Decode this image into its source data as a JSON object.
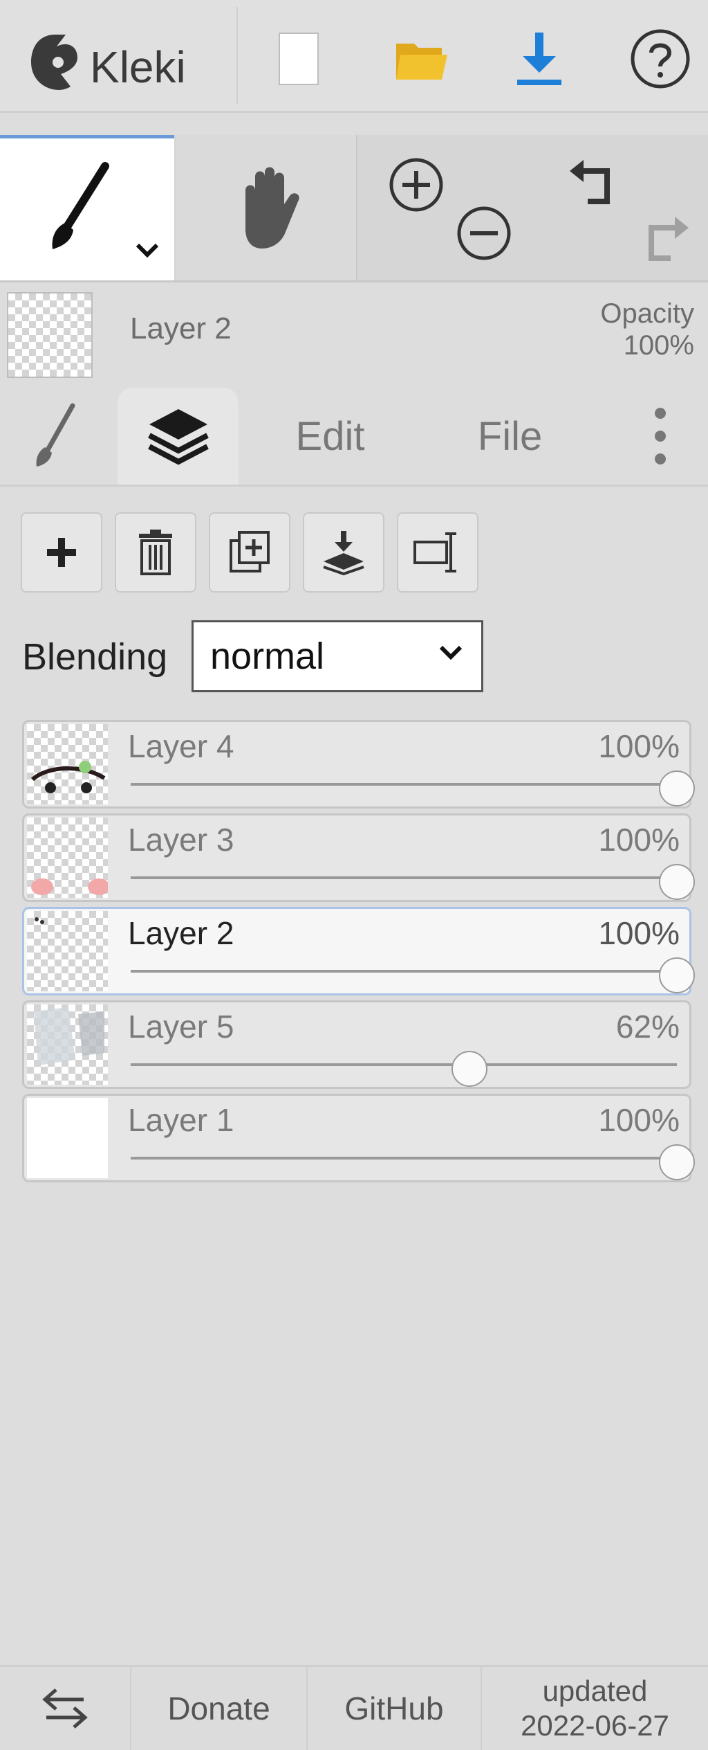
{
  "app": {
    "name": "Kleki"
  },
  "header": {
    "layer_name": "Layer 2",
    "opacity_label": "Opacity",
    "opacity_value": "100%"
  },
  "tabs": [
    {
      "label": "",
      "icon": "brush-icon"
    },
    {
      "label": "",
      "icon": "layers-icon",
      "active": true
    },
    {
      "label": "Edit"
    },
    {
      "label": "File"
    },
    {
      "label": "",
      "icon": "more-vertical-icon"
    }
  ],
  "actions": [
    "add-layer-icon",
    "delete-layer-icon",
    "duplicate-layer-icon",
    "merge-down-icon",
    "rename-layer-icon"
  ],
  "blending": {
    "label": "Blending",
    "value": "normal"
  },
  "layers": [
    {
      "name": "Layer 4",
      "opacity": "100%",
      "opacity_fraction": 1.0
    },
    {
      "name": "Layer 3",
      "opacity": "100%",
      "opacity_fraction": 1.0
    },
    {
      "name": "Layer 2",
      "opacity": "100%",
      "opacity_fraction": 1.0,
      "selected": true
    },
    {
      "name": "Layer 5",
      "opacity": "62%",
      "opacity_fraction": 0.62
    },
    {
      "name": "Layer 1",
      "opacity": "100%",
      "opacity_fraction": 1.0
    }
  ],
  "footer": {
    "donate": "Donate",
    "github": "GitHub",
    "updated_label": "updated",
    "updated_date": "2022-06-27"
  },
  "colors": {
    "accent": "#1e7fd8",
    "folder": "#f2c12e",
    "selected_border": "#a9c3e6"
  }
}
